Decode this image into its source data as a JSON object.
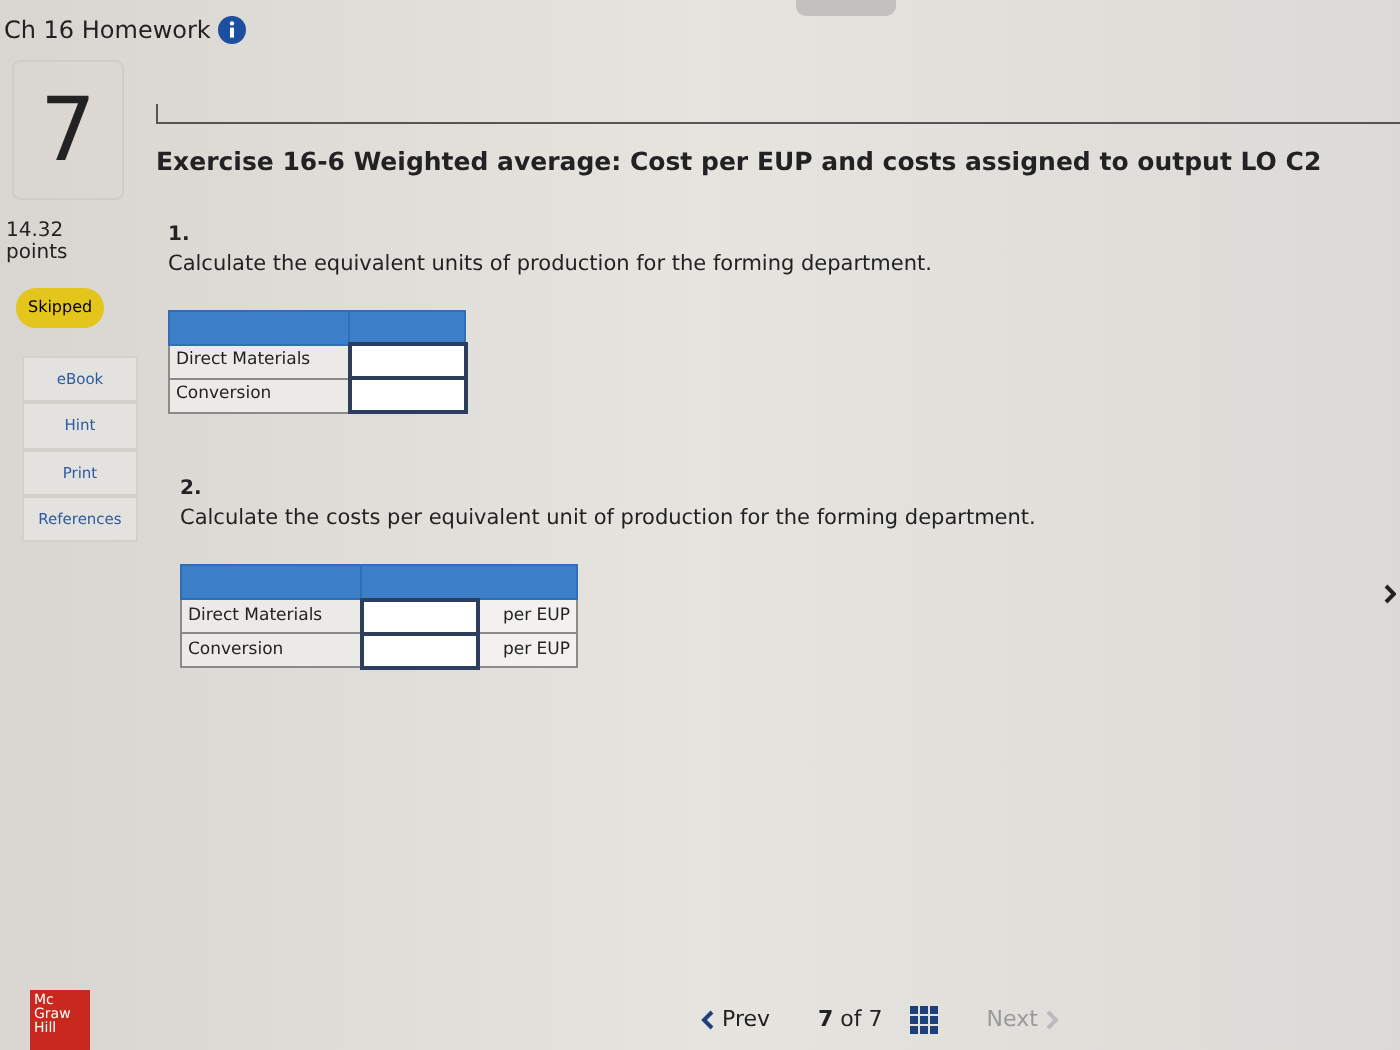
{
  "header": {
    "title": "Ch 16 Homework"
  },
  "question": {
    "number": "7",
    "title": "Exercise 16-6 Weighted average: Cost per EUP and costs assigned to output LO C2",
    "points": "14.32",
    "points_label": "points",
    "status": "Skipped"
  },
  "resources": [
    {
      "label": "eBook"
    },
    {
      "label": "Hint"
    },
    {
      "label": "Print"
    },
    {
      "label": "References"
    }
  ],
  "parts": [
    {
      "number": "1.",
      "prompt": "Calculate the equivalent units of production for the forming department.",
      "rows": [
        {
          "label": "Direct Materials"
        },
        {
          "label": "Conversion"
        }
      ]
    },
    {
      "number": "2.",
      "prompt": "Calculate the costs per equivalent unit of production for the forming department.",
      "rows": [
        {
          "label": "Direct Materials",
          "unit": "per EUP"
        },
        {
          "label": "Conversion",
          "unit": "per EUP"
        }
      ]
    }
  ],
  "footer": {
    "logo": [
      "Mc",
      "Graw",
      "Hill"
    ],
    "prev": "Prev",
    "position": "**7** of 7",
    "next": "Next",
    "next_disabled": true
  }
}
